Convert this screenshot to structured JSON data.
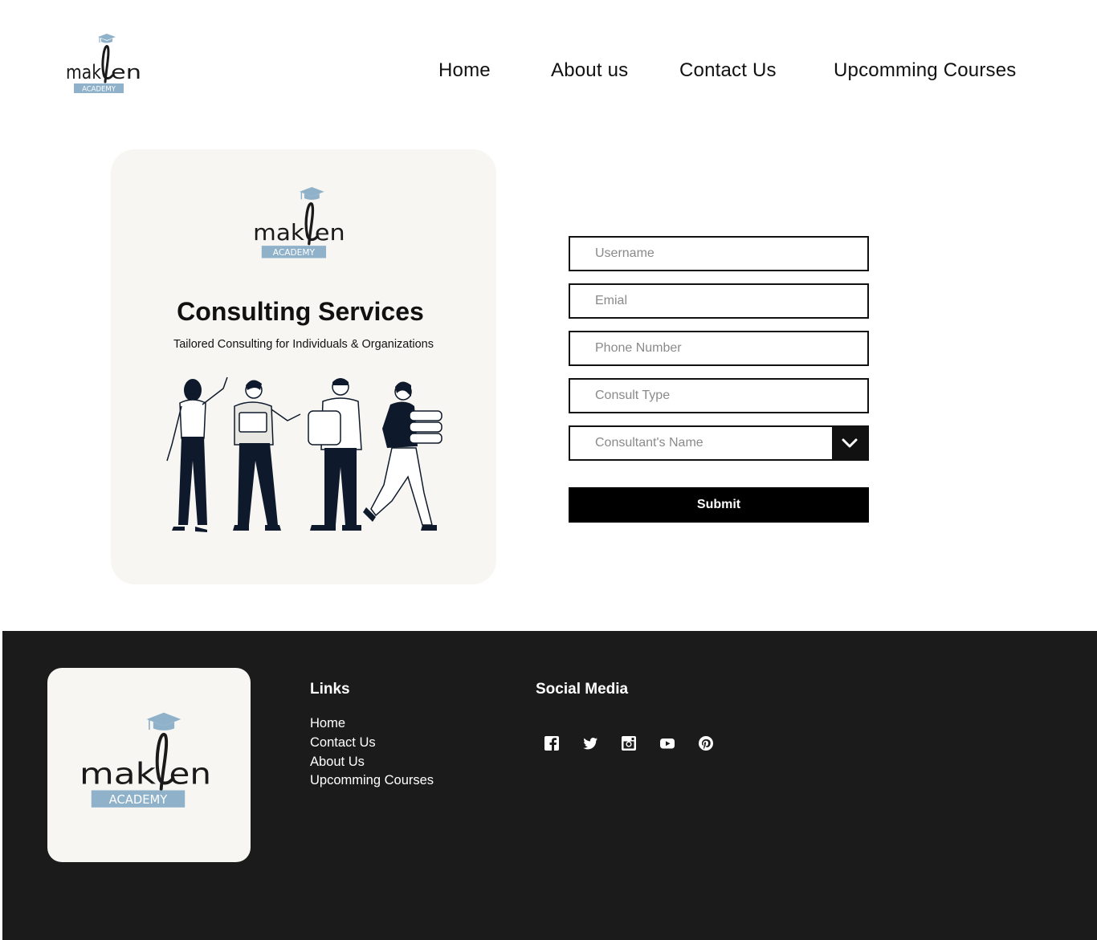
{
  "brand": {
    "wordmark": "maklen",
    "tagline": "ACADEMY",
    "accent": "#8fb1c9",
    "dark": "#1a1a1a"
  },
  "nav": {
    "home": "Home",
    "about": "About us",
    "contact": "Contact Us",
    "courses": "Upcomming Courses"
  },
  "card": {
    "title": "Consulting Services",
    "subtitle": "Tailored Consulting for Individuals & Organizations",
    "background": "#f7f6f2"
  },
  "form": {
    "username_placeholder": "Username",
    "email_placeholder": "Emial",
    "phone_placeholder": "Phone Number",
    "consult_type_placeholder": "Consult Type",
    "consultant_placeholder": "Consultant's Name",
    "submit_label": "Submit"
  },
  "footer": {
    "links_heading": "Links",
    "links": [
      "Home",
      "Contact Us",
      "About Us",
      "Upcomming Courses"
    ],
    "social_heading": "Social Media",
    "social_icons": [
      "facebook-icon",
      "twitter-icon",
      "instagram-icon",
      "youtube-icon",
      "pinterest-icon"
    ],
    "background": "#1b1b1b"
  }
}
